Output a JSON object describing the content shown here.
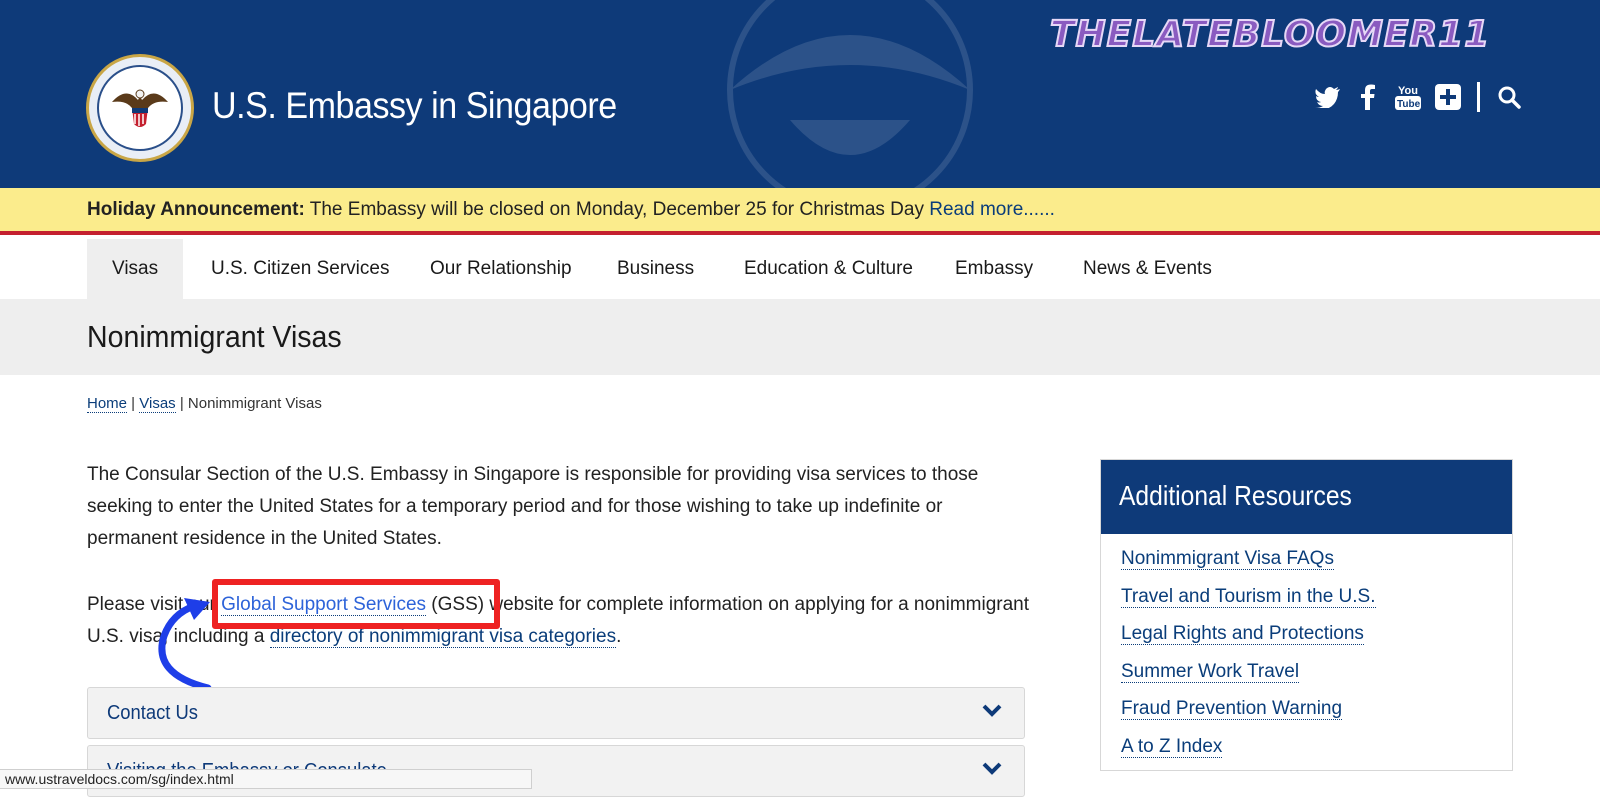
{
  "header": {
    "site_title": "U.S. Embassy in Singapore",
    "watermark": "THELATEBLOOMER11",
    "social": [
      "twitter-icon",
      "facebook-icon",
      "youtube-icon",
      "plus-icon",
      "search-icon"
    ],
    "colors": {
      "header_bg": "#0e3a79",
      "announce_bg": "#fbec8c",
      "accent_red": "#c4202f"
    }
  },
  "announcement": {
    "label": "Holiday Announcement:",
    "text": " The Embassy will be closed on Monday, December 25 for Christmas Day ",
    "link": "Read more......"
  },
  "nav": {
    "items": [
      {
        "label": "Visas",
        "active": true
      },
      {
        "label": "U.S. Citizen Services"
      },
      {
        "label": "Our Relationship"
      },
      {
        "label": "Business"
      },
      {
        "label": "Education & Culture"
      },
      {
        "label": "Embassy"
      },
      {
        "label": "News & Events"
      }
    ]
  },
  "page": {
    "title": "Nonimmigrant Visas"
  },
  "breadcrumb": {
    "home": "Home",
    "sep1": " | ",
    "visas": "Visas",
    "sep2": " | ",
    "current": "Nonimmigrant Visas"
  },
  "content": {
    "para1": "The Consular Section of the U.S. Embassy in Singapore is responsible for providing visa services to those seeking to enter the United States for a temporary period and for those wishing to take up indefinite or permanent residence in the United States.",
    "para2_pre": "Please visit our ",
    "para2_link": "Global Support Services",
    "para2_mid": " (GSS) website for complete information on applying for a nonimmigrant U.S. visa, including a ",
    "para2_link2": "directory of nonimmigrant visa categories",
    "para2_end": "."
  },
  "accordions": [
    {
      "label": "Contact Us"
    },
    {
      "label": "Visiting the Embassy or Consulate"
    }
  ],
  "sidebar": {
    "title": "Additional Resources",
    "links": [
      "Nonimmigrant Visa FAQs",
      "Travel and Tourism in the U.S.",
      "Legal Rights and Protections",
      "Summer Work Travel",
      "Fraud Prevention Warning",
      "A to Z Index"
    ]
  },
  "statusbar": {
    "url": "www.ustraveldocs.com/sg/index.html"
  }
}
